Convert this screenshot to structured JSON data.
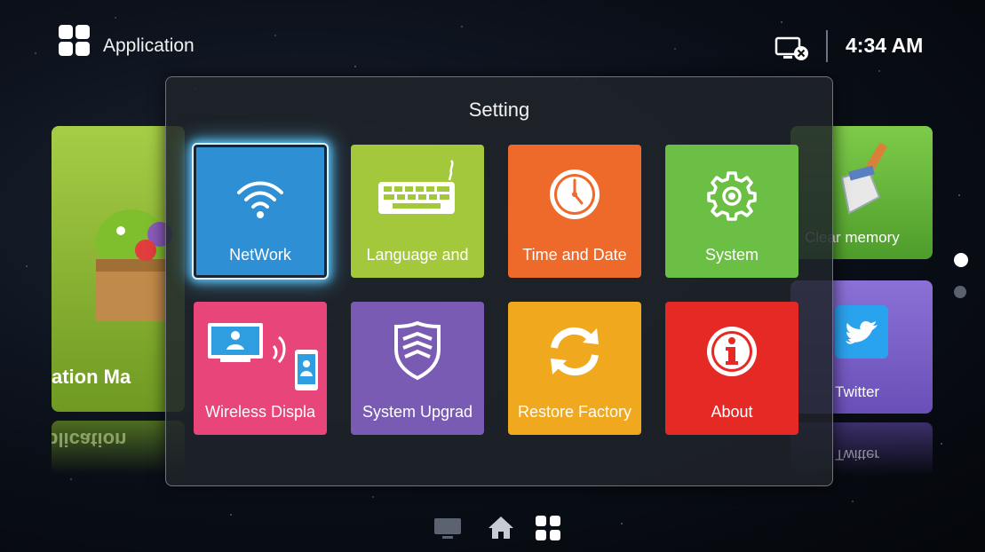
{
  "topbar": {
    "title": "Application",
    "apps_icon": "apps-grid-icon",
    "status_icon": "screen-disconnected-icon",
    "time": "4:34 AM"
  },
  "background": {
    "app_manager_label": "ation Ma",
    "app_manager_reflection": "plication",
    "clear_memory_label": "Clear memory",
    "twitter_label": "Twitter",
    "twitter_reflection": "Twitter",
    "pager": {
      "total": 2,
      "active": 1
    }
  },
  "dialog": {
    "title": "Setting",
    "tiles": [
      {
        "label": "NetWork",
        "icon": "wifi-icon",
        "color": "#2f8fd4",
        "focused": true
      },
      {
        "label": "Language and",
        "icon": "keyboard-icon",
        "color": "#a4c83c",
        "focused": false
      },
      {
        "label": "Time and Date",
        "icon": "clock-icon",
        "color": "#ee6a2a",
        "focused": false
      },
      {
        "label": "System",
        "icon": "gear-icon",
        "color": "#6cbf45",
        "focused": false
      },
      {
        "label": "Wireless Displa",
        "icon": "wireless-display-icon",
        "color": "#e8457a",
        "focused": false
      },
      {
        "label": "System Upgrad",
        "icon": "shield-icon",
        "color": "#7a5bb4",
        "focused": false
      },
      {
        "label": "Restore Factory",
        "icon": "refresh-icon",
        "color": "#f0a81e",
        "focused": false
      },
      {
        "label": "About",
        "icon": "info-icon",
        "color": "#e52a26",
        "focused": false
      }
    ]
  },
  "bottom_nav": {
    "items": [
      "tv-icon",
      "home-icon",
      "apps-grid-icon"
    ],
    "active": "apps-grid-icon"
  },
  "colors": {
    "accent_focus": "#5cc8ff",
    "dialog_bg": "#20242a"
  }
}
